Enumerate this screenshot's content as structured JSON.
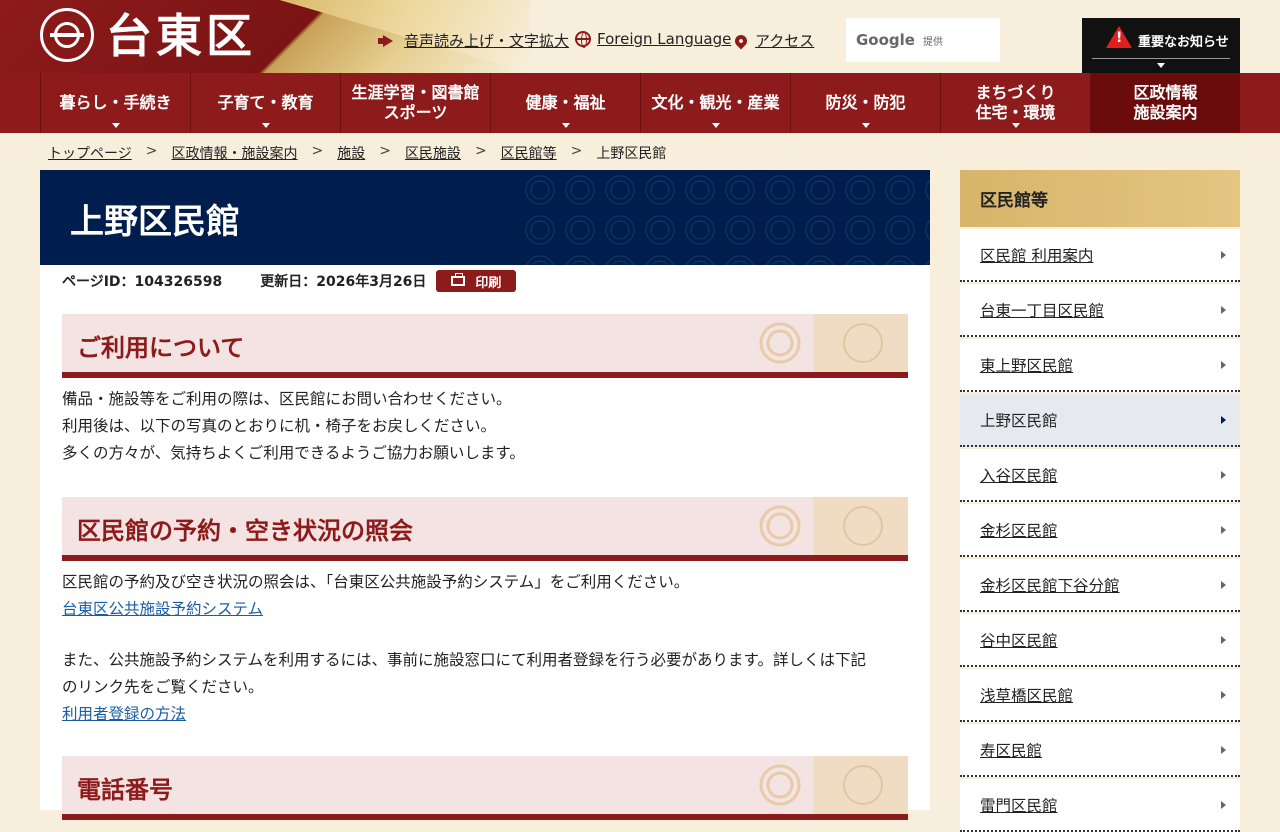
{
  "header": {
    "logo_text": "台東区",
    "voice_link": "音声読み上げ・文字拡大",
    "lang_link": "Foreign Language",
    "access_link": "アクセス",
    "search_brand": "Google",
    "search_suffix": "提供",
    "notice_label": "重要なお知らせ"
  },
  "nav": {
    "items": [
      {
        "line1": "暮らし・手続き",
        "line2": ""
      },
      {
        "line1": "子育て・教育",
        "line2": ""
      },
      {
        "line1": "生涯学習・図書館",
        "line2": "スポーツ"
      },
      {
        "line1": "健康・福祉",
        "line2": ""
      },
      {
        "line1": "文化・観光・産業",
        "line2": ""
      },
      {
        "line1": "防災・防犯",
        "line2": ""
      },
      {
        "line1": "まちづくり",
        "line2": "住宅・環境"
      },
      {
        "line1": "区政情報",
        "line2": "施設案内"
      }
    ]
  },
  "breadcrumb": {
    "items": [
      "トップページ",
      "区政情報・施設案内",
      "施設",
      "区民施設",
      "区民館等"
    ],
    "current": "上野区民館",
    "separator": ">"
  },
  "page": {
    "title": "上野区民館",
    "page_id": "ページID：104326598",
    "updated": "更新日：2026年3月26日",
    "print_label": "印刷"
  },
  "sections": [
    {
      "heading": "ご利用について",
      "lines": [
        "備品・施設等をご利用の際は、区民館にお問い合わせください。",
        "利用後は、以下の写真のとおりに机・椅子をお戻しください。",
        "多くの方々が、気持ちよくご利用できるようご協力お願いします。"
      ]
    },
    {
      "heading": "区民館の予約・空き状況の照会",
      "p1": "区民館の予約及び空き状況の照会は、「台東区公共施設予約システム」をご利用ください。",
      "link1": "台東区公共施設予約システム",
      "p2a": "また、公共施設予約システムを利用するには、事前に施設窓口にて利用者登録を行う必要があります。詳しくは下記",
      "p2b": "のリンク先をご覧ください。",
      "link2": "利用者登録の方法"
    },
    {
      "heading": "電話番号"
    }
  ],
  "sidebar": {
    "heading": "区民館等",
    "items": [
      "区民館 利用案内",
      "台東一丁目区民館",
      "東上野区民館",
      "上野区民館",
      "入谷区民館",
      "金杉区民館",
      "金杉区民館下谷分館",
      "谷中区民館",
      "浅草橋区民館",
      "寿区民館",
      "雷門区民館"
    ],
    "current_index": 3
  },
  "colors": {
    "brand_red": "#8e1b1b",
    "navy": "#001e4d",
    "gold": "#d7b56a",
    "background": "#f7efdc"
  }
}
